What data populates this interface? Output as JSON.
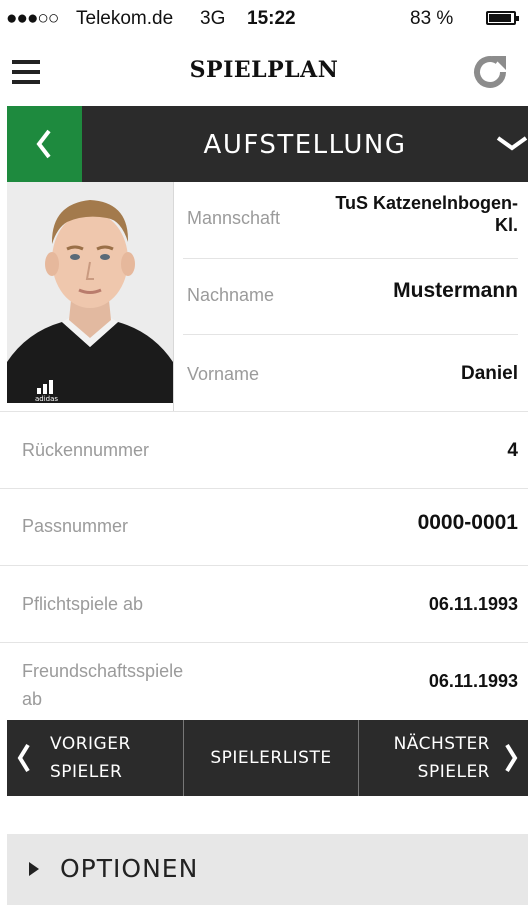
{
  "status_bar": {
    "signal": "●●●○○",
    "carrier": "Telekom.de",
    "network": "3G",
    "time": "15:22",
    "battery": "83 %"
  },
  "header": {
    "title": "SPIELPLAN",
    "menu_icon": "hamburger-menu-icon",
    "refresh_icon": "refresh-icon"
  },
  "section": {
    "title": "AUFSTELLUNG",
    "accent_color": "#1e8a3e"
  },
  "player": {
    "photo_icon": "player-photo",
    "fields": [
      {
        "label": "Mannschaft",
        "value": "TuS Katzenelnbogen-\nKl."
      },
      {
        "label": "Nachname",
        "value": "Mustermann"
      },
      {
        "label": "Vorname",
        "value": "Daniel"
      }
    ],
    "details": [
      {
        "label": "Rückennummer",
        "value": "4"
      },
      {
        "label": "Passnummer",
        "value": "0000-0001"
      },
      {
        "label": "Pflichtspiele ab",
        "value": "06.11.1993"
      },
      {
        "label": "Freundschaftsspiele\nab",
        "value": "06.11.1993"
      }
    ]
  },
  "navigation": {
    "prev_line1": "VORIGER",
    "prev_line2": "SPIELER",
    "list": "SPIELERLISTE",
    "next_line1": "NÄCHSTER",
    "next_line2": "SPIELER"
  },
  "options": {
    "label": "OPTIONEN"
  }
}
